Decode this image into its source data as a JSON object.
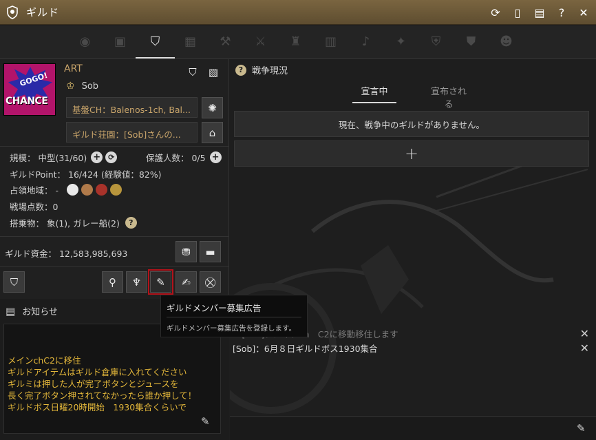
{
  "window": {
    "title": "ギルド",
    "icons": [
      "refresh-icon",
      "phone-icon",
      "document-icon",
      "help-icon",
      "close-icon"
    ]
  },
  "tabs": [
    {
      "name": "tab-emblem",
      "icon": "emblem-icon"
    },
    {
      "name": "tab-members",
      "icon": "members-icon"
    },
    {
      "name": "tab-guild",
      "icon": "guild-crest-icon",
      "active": true
    },
    {
      "name": "tab-quest",
      "icon": "quest-icon"
    },
    {
      "name": "tab-craft",
      "icon": "craft-icon"
    },
    {
      "name": "tab-battle",
      "icon": "crossed-swords-icon"
    },
    {
      "name": "tab-castle",
      "icon": "castle-icon"
    },
    {
      "name": "tab-history",
      "icon": "scroll-icon"
    },
    {
      "name": "tab-alerts",
      "icon": "bell-icon"
    },
    {
      "name": "tab-league",
      "icon": "wings-icon"
    },
    {
      "name": "tab-armor",
      "icon": "armor-icon"
    },
    {
      "name": "tab-alliance",
      "icon": "shield-icon"
    },
    {
      "name": "tab-pets",
      "icon": "mask-icon"
    }
  ],
  "guild": {
    "logo_top": "GOGO!",
    "logo_bottom": "CHANCE",
    "name": "ART",
    "master": "Sob",
    "base_channel": "基盤CH：Balenos-1ch, Bal...",
    "estate": "ギルド荘園：[Sob]さんの...",
    "size": "規模： 中型(31/60)",
    "protect": "保護人数： 0/5",
    "points": "ギルドPoint： 16/424 (経験値：82%)",
    "territory_label": "占領地域：  -",
    "battle_points": "戦場点数：0",
    "mounts": "搭乗物： 象(1), ガレー船(2)",
    "funds": "ギルド資金： 12,583,985,693"
  },
  "notice": {
    "title": "お知らせ",
    "lines": [
      "メインchC2に移住",
      "ギルドアイテムはギルド倉庫に入れてください",
      "ギルミは押した人が完了ボタンとジュースを",
      "長く完了ボタン押されてなかったら誰か押して！",
      "ギルドボス日曜20時開始　1930集合くらいで"
    ]
  },
  "war": {
    "title": "戦争現況",
    "tab_declared": "宣言中",
    "tab_received": "宣布される",
    "empty": "現在、戦争中のギルドがありません。",
    "add": "+"
  },
  "chat": [
    {
      "text": "N [Sob]：メインch　C2に移動移住します"
    },
    {
      "text": "[Sob]：6月８日ギルドボス1930集合"
    }
  ],
  "tooltip": {
    "title": "ギルドメンバー募集広告",
    "desc": "ギルドメンバー募集広告を登録します。"
  },
  "colors": {
    "accent_gold": "#c8a46a",
    "notice_text": "#e2b63a",
    "titlebar": "#6b5836",
    "highlight": "#b3121a"
  }
}
